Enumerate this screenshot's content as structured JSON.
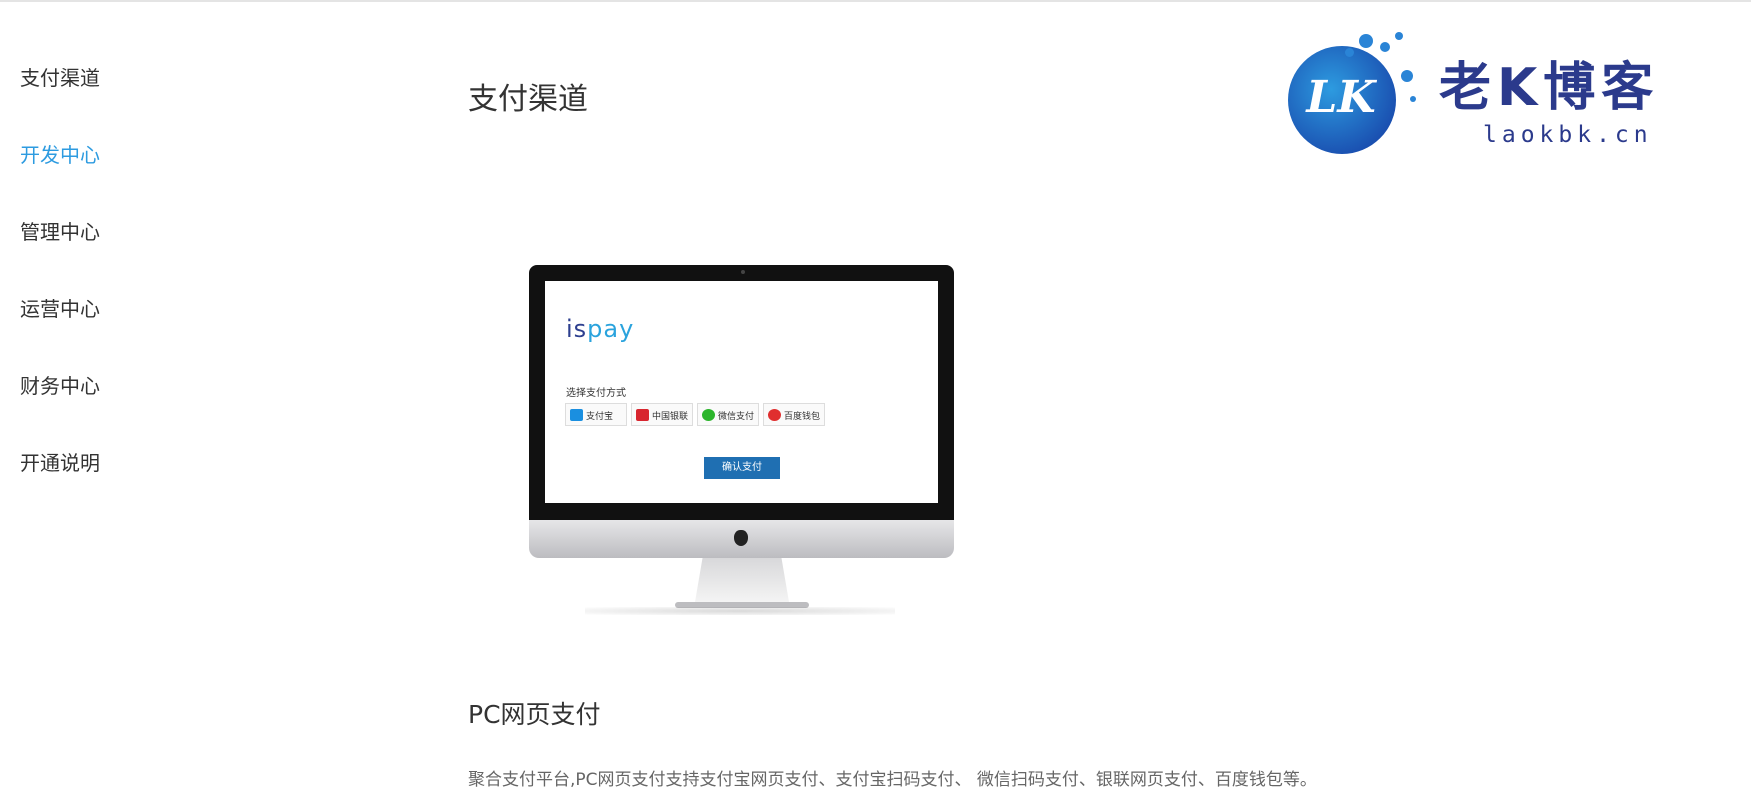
{
  "sidebar": {
    "items": [
      {
        "label": "支付渠道",
        "active": false
      },
      {
        "label": "开发中心",
        "active": true
      },
      {
        "label": "管理中心",
        "active": false
      },
      {
        "label": "运营中心",
        "active": false
      },
      {
        "label": "财务中心",
        "active": false
      },
      {
        "label": "开通说明",
        "active": false
      }
    ]
  },
  "main": {
    "title": "支付渠道",
    "illustration": {
      "brand_is": "is",
      "brand_pay": "pay",
      "select_label": "选择支付方式",
      "methods": [
        {
          "label": "支付宝",
          "icon": "alipay-icon",
          "color": "#1a8fe0"
        },
        {
          "label": "中国银联",
          "icon": "unionpay-icon",
          "color": "#d8262f"
        },
        {
          "label": "微信支付",
          "icon": "wechat-pay-icon",
          "color": "#2cb52c"
        },
        {
          "label": "百度钱包",
          "icon": "baidu-wallet-icon",
          "color": "#e02f2f"
        }
      ],
      "confirm_label": "确认支付"
    },
    "section_title": "PC网页支付",
    "section_desc": "聚合支付平台,PC网页支付支持支付宝网页支付、支付宝扫码支付、 微信扫码支付、银联网页支付、百度钱包等。"
  },
  "watermark": {
    "mark": "LK",
    "title": "老K博客",
    "url": "laokbk.cn"
  },
  "colors": {
    "accent": "#2d9be0",
    "text": "#333333",
    "logo_blue": "#2b3a8c"
  }
}
